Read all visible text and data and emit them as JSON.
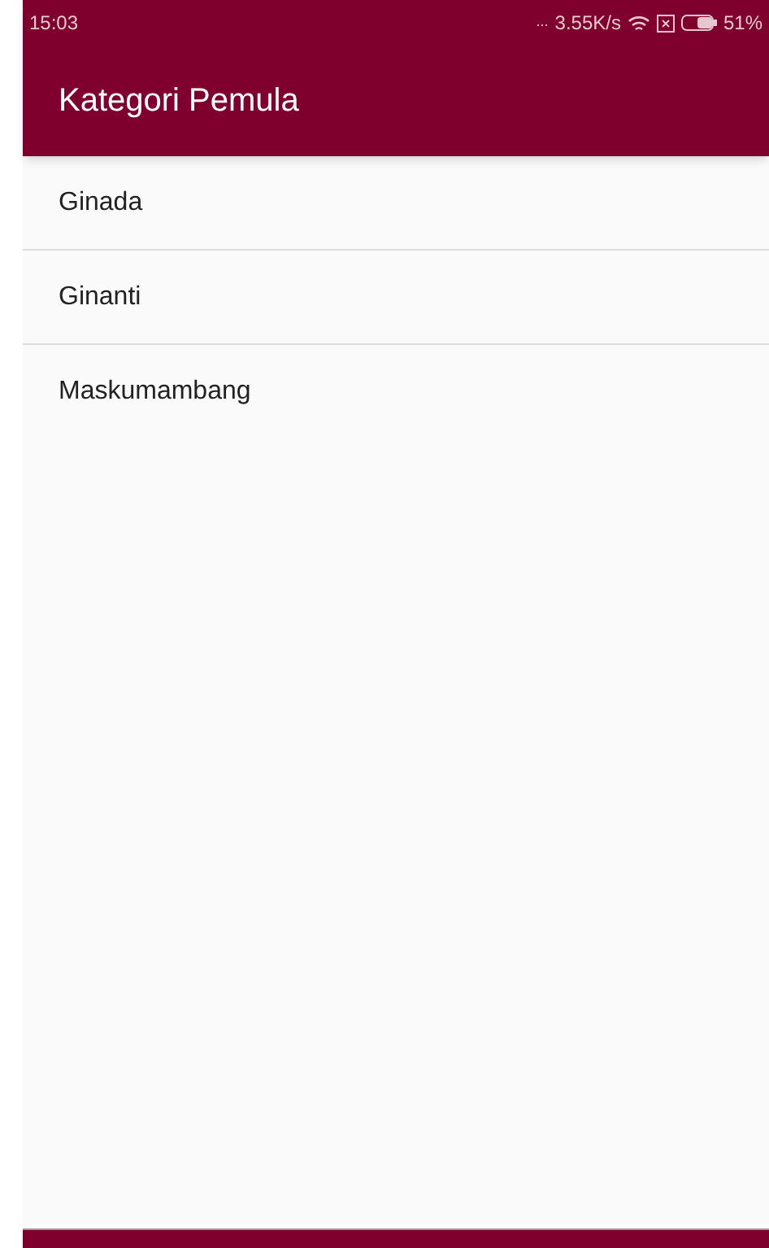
{
  "status_bar": {
    "time": "15:03",
    "signal": "...",
    "speed": "3.55K/s",
    "battery": "51%"
  },
  "app_bar": {
    "title": "Kategori Pemula"
  },
  "items": [
    {
      "label": "Ginada"
    },
    {
      "label": "Ginanti"
    },
    {
      "label": "Maskumambang"
    }
  ]
}
